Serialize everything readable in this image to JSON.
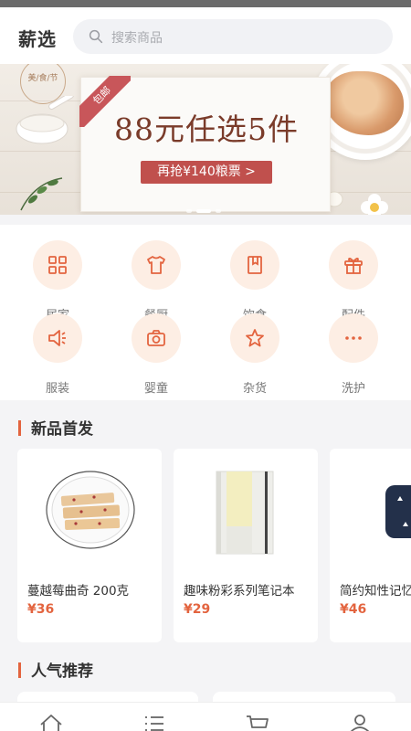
{
  "header": {
    "brand": "薪选",
    "search_placeholder": "搜索商品"
  },
  "banner": {
    "stamp_text": "美/食/节",
    "ribbon": "包邮",
    "headline": "88元任选5件",
    "cta": "再抢¥140粮票 >",
    "active_dot": 1
  },
  "categories": [
    {
      "label": "居家",
      "icon": "grid-icon"
    },
    {
      "label": "餐厨",
      "icon": "shirt-icon"
    },
    {
      "label": "饮食",
      "icon": "book-icon"
    },
    {
      "label": "配件",
      "icon": "gift-icon"
    },
    {
      "label": "服装",
      "icon": "megaphone-icon"
    },
    {
      "label": "婴童",
      "icon": "camera-icon"
    },
    {
      "label": "杂货",
      "icon": "star-icon"
    },
    {
      "label": "洗护",
      "icon": "more-icon"
    }
  ],
  "new_arrivals": {
    "title": "新品首发",
    "products": [
      {
        "name": "蔓越莓曲奇 200克",
        "price": "¥36"
      },
      {
        "name": "趣味粉彩系列笔记本",
        "price": "¥29"
      },
      {
        "name": "简约知性记忆",
        "price": "¥46"
      }
    ]
  },
  "popular": {
    "title": "人气推荐"
  },
  "tabbar": {
    "tabs": [
      {
        "icon": "home-icon"
      },
      {
        "icon": "list-icon"
      },
      {
        "icon": "cart-icon"
      },
      {
        "icon": "user-icon"
      }
    ]
  },
  "colors": {
    "accent": "#e3643f",
    "banner_red": "#c0504d",
    "icon_bg": "#fdeee4"
  }
}
